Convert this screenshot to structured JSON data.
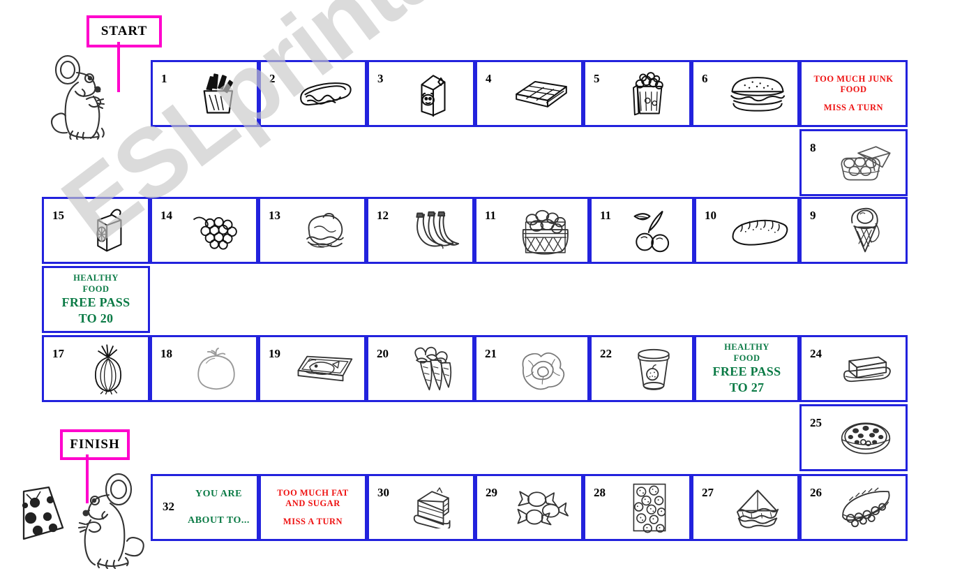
{
  "watermark": {
    "text": "ESLprintables.com"
  },
  "signs": {
    "start": "START",
    "finish": "FINISH"
  },
  "decorations": [
    {
      "name": "mouse-start",
      "label": "mouse holding start sign"
    },
    {
      "name": "mouse-finish",
      "label": "mouse holding finish sign"
    },
    {
      "name": "cheese",
      "label": "cheese wedge"
    }
  ],
  "board": {
    "row1": [
      {
        "num": "1",
        "icon": "french-fries-icon",
        "type": "food"
      },
      {
        "num": "2",
        "icon": "hot-dog-icon",
        "type": "food"
      },
      {
        "num": "3",
        "icon": "milk-carton-icon",
        "type": "food"
      },
      {
        "num": "4",
        "icon": "chocolate-bar-icon",
        "type": "food"
      },
      {
        "num": "5",
        "icon": "popcorn-icon",
        "type": "food"
      },
      {
        "num": "6",
        "icon": "hamburger-icon",
        "type": "food"
      }
    ],
    "penalty_junk": {
      "line1": "TOO MUCH JUNK",
      "line2": "FOOD",
      "line3": "MISS A TURN"
    },
    "cell8": {
      "num": "8",
      "icon": "egg-carton-icon",
      "type": "food"
    },
    "row2": [
      {
        "num": "15",
        "icon": "juice-box-icon",
        "type": "food"
      },
      {
        "num": "14",
        "icon": "grapes-icon",
        "type": "food"
      },
      {
        "num": "13",
        "icon": "roast-chicken-icon",
        "type": "food"
      },
      {
        "num": "12",
        "icon": "bananas-icon",
        "type": "food"
      },
      {
        "num": "11",
        "icon": "potato-basket-icon",
        "type": "food"
      },
      {
        "num": "11",
        "icon": "cherries-icon",
        "type": "food"
      },
      {
        "num": "10",
        "icon": "bread-loaf-icon",
        "type": "food"
      },
      {
        "num": "9",
        "icon": "ice-cream-cone-icon",
        "type": "food"
      }
    ],
    "bonus_20": {
      "line1": "HEALTHY",
      "line2": "FOOD",
      "line3": "FREE PASS",
      "line4": "TO 20"
    },
    "row3": [
      {
        "num": "17",
        "icon": "onion-icon",
        "type": "food"
      },
      {
        "num": "18",
        "icon": "tomato-icon",
        "type": "food"
      },
      {
        "num": "19",
        "icon": "fish-tray-icon",
        "type": "food"
      },
      {
        "num": "20",
        "icon": "carrots-icon",
        "type": "food"
      },
      {
        "num": "21",
        "icon": "lettuce-icon",
        "type": "food"
      },
      {
        "num": "22",
        "icon": "yogurt-cup-icon",
        "type": "food"
      }
    ],
    "bonus_27": {
      "line1": "HEALTHY",
      "line2": "FOOD",
      "line3": "FREE PASS",
      "line4": "TO 27"
    },
    "cell24": {
      "num": "24",
      "icon": "butter-icon",
      "type": "food"
    },
    "cell25": {
      "num": "25",
      "icon": "pizza-icon",
      "type": "food"
    },
    "row4": [
      {
        "num": "30",
        "icon": "cake-slice-icon",
        "type": "food"
      },
      {
        "num": "29",
        "icon": "candy-icon",
        "type": "food"
      },
      {
        "num": "28",
        "icon": "cookies-box-icon",
        "type": "food"
      },
      {
        "num": "27",
        "icon": "sandwich-icon",
        "type": "food"
      },
      {
        "num": "26",
        "icon": "pie-slice-icon",
        "type": "food"
      }
    ],
    "cell32": {
      "num": "32",
      "line1": "YOU ARE",
      "line2": "ABOUT TO..."
    },
    "penalty_fat": {
      "line1": "TOO MUCH FAT",
      "line2": "AND SUGAR",
      "line3": "MISS A TURN"
    }
  },
  "colors": {
    "cell_border": "#2222dd",
    "sign_border": "#ff00cc",
    "penalty_text": "#ee1111",
    "bonus_text": "#0a7a45",
    "watermark": "#c9c9c9"
  }
}
